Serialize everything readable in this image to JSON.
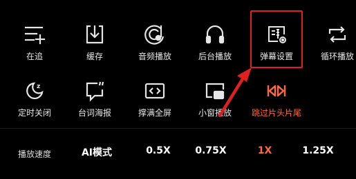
{
  "grid": {
    "rows": [
      [
        {
          "id": "follow",
          "label": "在追",
          "icon": "add-to-list-icon"
        },
        {
          "id": "cache",
          "label": "缓存",
          "icon": "download-icon"
        },
        {
          "id": "audio",
          "label": "音频播放",
          "icon": "music-disc-icon"
        },
        {
          "id": "background",
          "label": "后台播放",
          "icon": "headphones-icon"
        },
        {
          "id": "danmaku",
          "label": "弹幕设置",
          "icon": "danmaku-settings-icon"
        },
        {
          "id": "loop",
          "label": "循环播放",
          "icon": "repeat-icon"
        }
      ],
      [
        {
          "id": "timer",
          "label": "定时关闭",
          "icon": "sleep-moon-icon"
        },
        {
          "id": "poster",
          "label": "台词海报",
          "icon": "quote-bubble-icon"
        },
        {
          "id": "fullscreen",
          "label": "撑满全屏",
          "icon": "stretch-screen-icon"
        },
        {
          "id": "pip",
          "label": "小窗播放",
          "icon": "picture-in-picture-icon"
        },
        {
          "id": "skip",
          "label": "跳过片头片尾",
          "icon": "skip-intro-outro-icon"
        }
      ]
    ]
  },
  "speed": {
    "label": "播放速度",
    "options": [
      "AI模式",
      "0.5X",
      "0.75X",
      "1X",
      "1.25X"
    ],
    "selected": "1X"
  },
  "colors": {
    "background": "#000000",
    "text": "#e6e6e6",
    "accent": "#ff6a3c",
    "annotation": "#e02020"
  }
}
